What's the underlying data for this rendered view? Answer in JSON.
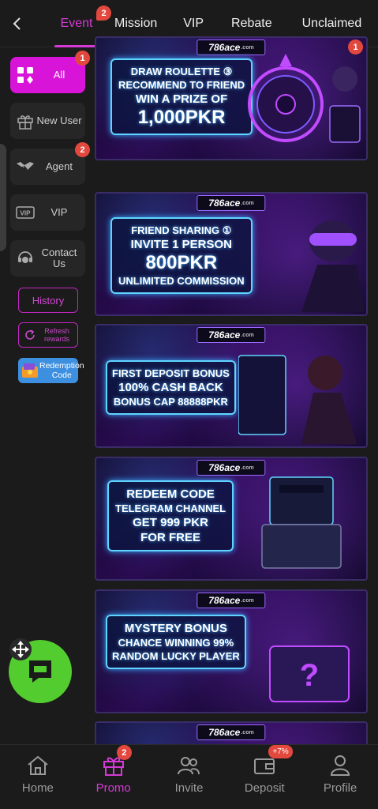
{
  "header": {
    "tabs": [
      {
        "label": "Event",
        "badge": "2",
        "active": true
      },
      {
        "label": "Mission"
      },
      {
        "label": "VIP"
      },
      {
        "label": "Rebate"
      },
      {
        "label": "Unclaimed"
      }
    ]
  },
  "sidebar": {
    "items": [
      {
        "label": "All",
        "badge": "1",
        "icon": "grid-icon",
        "active": true
      },
      {
        "label": "New User",
        "icon": "gift-icon"
      },
      {
        "label": "Agent",
        "badge": "2",
        "icon": "handshake-icon"
      },
      {
        "label": "VIP",
        "icon": "vip-icon"
      },
      {
        "label": "Contact Us",
        "icon": "support-icon"
      }
    ],
    "history_label": "History",
    "refresh_label": "Refresh rewards",
    "redeem_label": "Redemption Code"
  },
  "banners": [
    {
      "logo": "786ace",
      "logo_sub": ".com",
      "badge": "1",
      "lines": [
        "DRAW ROULETTE ③",
        "RECOMMEND TO FRIEND",
        "WIN A PRIZE OF",
        "1,000PKR"
      ]
    },
    {
      "logo": "786ace",
      "logo_sub": ".com",
      "lines": [
        "FRIEND SHARING ①",
        "INVITE 1 PERSON",
        "800PKR",
        "UNLIMITED COMMISSION"
      ]
    },
    {
      "logo": "786ace",
      "logo_sub": ".com",
      "lines": [
        "FIRST DEPOSIT BONUS",
        "100% CASH BACK",
        "BONUS CAP 88888PKR"
      ]
    },
    {
      "logo": "786ace",
      "logo_sub": ".com",
      "lines": [
        "REDEEM CODE",
        "TELEGRAM CHANNEL",
        "GET 999 PKR",
        "FOR FREE"
      ]
    },
    {
      "logo": "786ace",
      "logo_sub": ".com",
      "lines": [
        "MYSTERY BONUS",
        "CHANCE WINNING 99%",
        "RANDOM LUCKY PLAYER"
      ]
    },
    {
      "logo": "786ace",
      "logo_sub": ".com",
      "lines": []
    }
  ],
  "bottom_nav": [
    {
      "label": "Home",
      "icon": "home-icon"
    },
    {
      "label": "Promo",
      "icon": "gift-icon",
      "badge": "2",
      "active": true
    },
    {
      "label": "Invite",
      "icon": "people-icon"
    },
    {
      "label": "Deposit",
      "icon": "wallet-icon",
      "tag": "+7%"
    },
    {
      "label": "Profile",
      "icon": "person-icon"
    }
  ],
  "colors": {
    "accent": "#d814d8",
    "badge": "#e2483e",
    "chat": "#52cc2e",
    "background": "#1b1b1b"
  }
}
